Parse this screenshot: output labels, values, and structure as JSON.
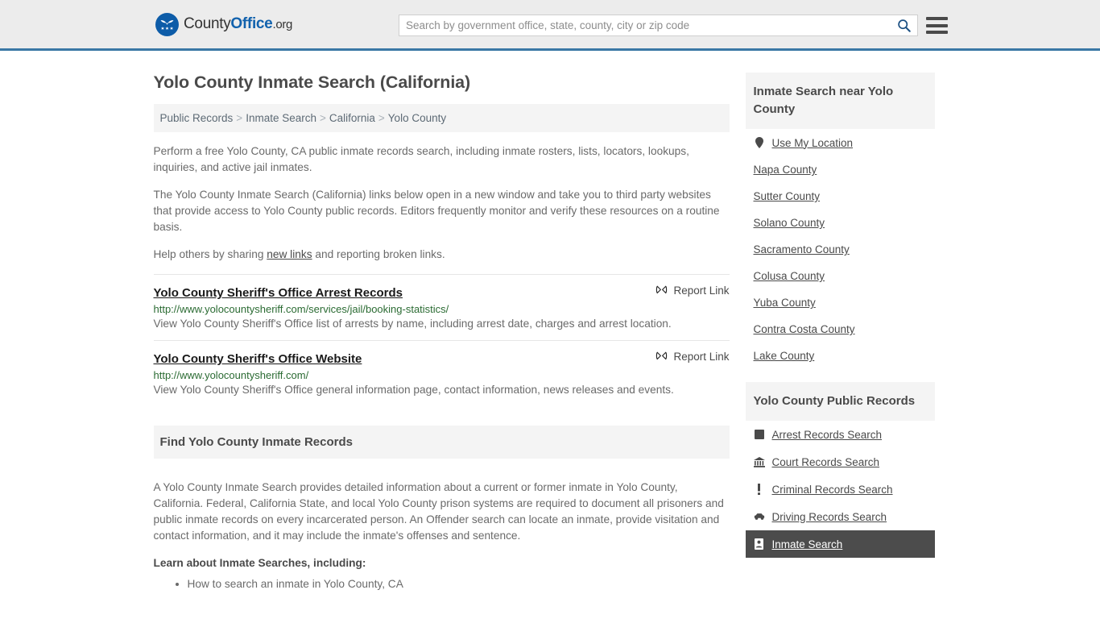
{
  "header": {
    "logo": {
      "part1": "County",
      "part2": "Office",
      "part3": ".org",
      "icon": "eagle-shield-stars-icon"
    },
    "search": {
      "placeholder": "Search by government office, state, county, city or zip code",
      "value": "",
      "icon": "search-icon"
    },
    "menu_icon": "hamburger-menu-icon",
    "accent_color": "#3a77a5",
    "background_color": "#ececec"
  },
  "main": {
    "title": "Yolo County Inmate Search (California)",
    "breadcrumb": [
      {
        "label": "Public Records"
      },
      {
        "label": "Inmate Search"
      },
      {
        "label": "California"
      },
      {
        "label": "Yolo County"
      }
    ],
    "breadcrumb_separator": ">",
    "intro_paragraphs": [
      "Perform a free Yolo County, CA public inmate records search, including inmate rosters, lists, locators, lookups, inquiries, and active jail inmates.",
      "The Yolo County Inmate Search (California) links below open in a new window and take you to third party websites that provide access to Yolo County public records. Editors frequently monitor and verify these resources on a routine basis."
    ],
    "help_text_before": "Help others by sharing ",
    "help_link": "new links",
    "help_text_after": " and reporting broken links.",
    "report_link_label": "Report Link",
    "report_link_icon": "broken-link-icon",
    "results": [
      {
        "title": "Yolo County Sheriff's Office Arrest Records",
        "url": "http://www.yolocountysheriff.com/services/jail/booking-statistics/",
        "description": "View Yolo County Sheriff's Office list of arrests by name, including arrest date, charges and arrest location."
      },
      {
        "title": "Yolo County Sheriff's Office Website",
        "url": "http://www.yolocountysheriff.com/",
        "description": "View Yolo County Sheriff's Office general information page, contact information, news releases and events."
      }
    ],
    "find_section": {
      "heading": "Find Yolo County Inmate Records",
      "body": "A Yolo County Inmate Search provides detailed information about a current or former inmate in Yolo County, California. Federal, California State, and local Yolo County prison systems are required to document all prisoners and public inmate records on every incarcerated person. An Offender search can locate an inmate, provide visitation and contact information, and it may include the inmate's offenses and sentence.",
      "learn_heading": "Learn about Inmate Searches, including:",
      "learn_items": [
        "How to search an inmate in Yolo County, CA"
      ]
    },
    "url_color": "#2b6b33"
  },
  "sidebar": {
    "near_section": {
      "heading": "Inmate Search near Yolo County",
      "items": [
        {
          "label": "Use My Location",
          "icon": "location-pin-icon"
        },
        {
          "label": "Napa County",
          "icon": ""
        },
        {
          "label": "Sutter County",
          "icon": ""
        },
        {
          "label": "Solano County",
          "icon": ""
        },
        {
          "label": "Sacramento County",
          "icon": ""
        },
        {
          "label": "Colusa County",
          "icon": ""
        },
        {
          "label": "Yuba County",
          "icon": ""
        },
        {
          "label": "Contra Costa County",
          "icon": ""
        },
        {
          "label": "Lake County",
          "icon": ""
        }
      ]
    },
    "records_section": {
      "heading": "Yolo County Public Records",
      "items": [
        {
          "label": "Arrest Records Search",
          "icon": "fingerprint-icon",
          "active": false
        },
        {
          "label": "Court Records Search",
          "icon": "courthouse-icon",
          "active": false
        },
        {
          "label": "Criminal Records Search",
          "icon": "exclamation-icon",
          "active": false
        },
        {
          "label": "Driving Records Search",
          "icon": "car-icon",
          "active": false
        },
        {
          "label": "Inmate Search",
          "icon": "id-card-icon",
          "active": true
        }
      ]
    },
    "active_background": "#4c4c4c"
  }
}
